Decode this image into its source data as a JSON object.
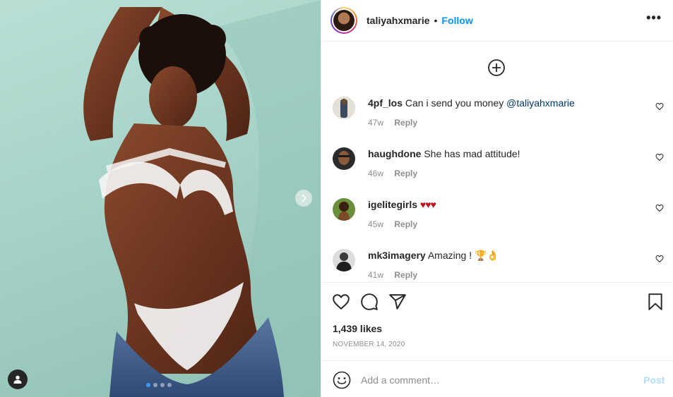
{
  "post": {
    "username": "taliyahxmarie",
    "bullet": "•",
    "follow_label": "Follow",
    "more_label": "•••",
    "more_icon": "more-horizontal-icon",
    "carousel": {
      "total": 4,
      "active": 1
    }
  },
  "comments": [
    {
      "username": "4pf_los",
      "text": "Can i send you money",
      "mention": "@taliyahxmarie",
      "time": "47w",
      "reply": "Reply"
    },
    {
      "username": "haughdone",
      "text": "She has mad attitude!",
      "time": "46w",
      "reply": "Reply"
    },
    {
      "username": "igelitegirls",
      "text": "♥♥♥",
      "time": "45w",
      "reply": "Reply"
    },
    {
      "username": "mk3imagery",
      "text": "Amazing ! 🏆👌",
      "time": "41w",
      "reply": "Reply"
    }
  ],
  "stats": {
    "likes": "1,439 likes",
    "date": "NOVEMBER 14, 2020"
  },
  "composer": {
    "placeholder": "Add a comment…",
    "post_label": "Post"
  },
  "colors": {
    "accent": "#0095f6",
    "post_disabled": "#b2dffc",
    "muted": "#8e8e8e",
    "mention": "#00376b"
  }
}
